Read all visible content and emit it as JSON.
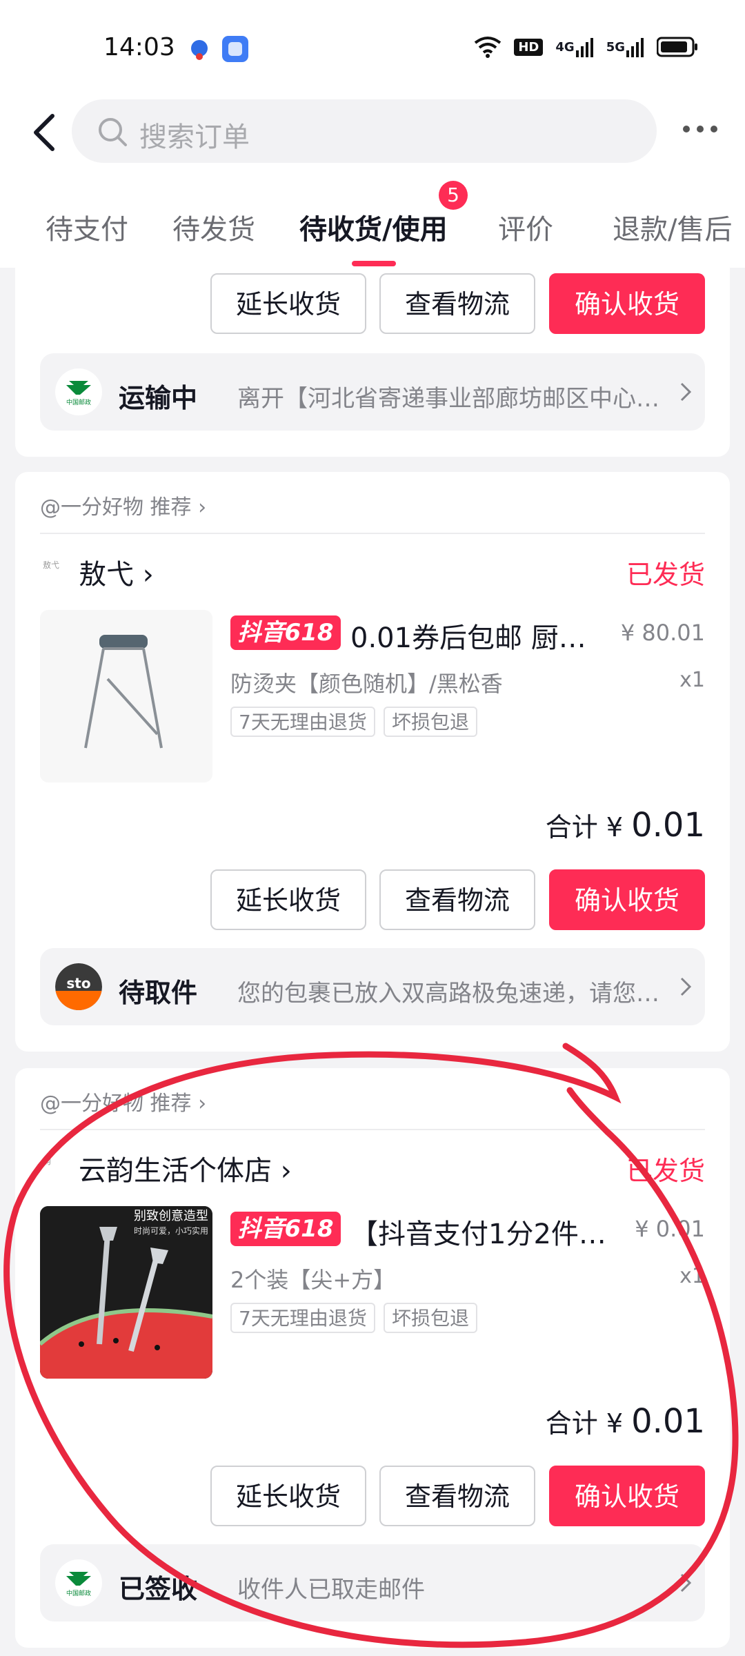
{
  "status_bar": {
    "time": "14:03",
    "network_badges": [
      "HD",
      "4G",
      "5G"
    ]
  },
  "search": {
    "placeholder": "搜索订单"
  },
  "tabs": [
    {
      "label": "待支付"
    },
    {
      "label": "待发货"
    },
    {
      "label": "待收货/使用",
      "badge": "5",
      "active": true
    },
    {
      "label": "评价"
    },
    {
      "label": "退款/售后"
    }
  ],
  "buttons": {
    "extend": "延长收货",
    "logistics": "查看物流",
    "confirm": "确认收货"
  },
  "orders": [
    {
      "logistics": {
        "carrier": "中国邮政 CHINA POST",
        "status": "运输中",
        "desc": "离开【河北省寄递事业部廊坊邮区中心邮…"
      }
    },
    {
      "recommend": "@一分好物 推荐",
      "shop": "敖弋",
      "shop_icon_text": "敖弋",
      "status": "已发货",
      "promo": "抖音618",
      "title": "0.01券后包邮 厨…",
      "price": "¥ 80.01",
      "sku": "防烫夹【颜色随机】/黑松香",
      "qty": "x1",
      "tags": [
        "7天无理由退货",
        "坏损包退"
      ],
      "total_label": "合计 ¥",
      "total_value": "0.01",
      "logistics": {
        "carrier": "sto express",
        "status": "待取件",
        "desc": "您的包裹已放入双高路极兔速递，请您尽…"
      }
    },
    {
      "recommend": "@一分好物 推荐",
      "shop": "云韵生活个体店",
      "shop_icon_text": "韵",
      "status": "已发货",
      "promo": "抖音618",
      "title": "【抖音支付1分2件…",
      "price": "¥ 0.01",
      "sku": "2个装【尖+方】",
      "qty": "x1",
      "thumb_text_1": "别致创意造型",
      "thumb_text_2": "时尚可爱，小巧实用",
      "tags": [
        "7天无理由退货",
        "坏损包退"
      ],
      "total_label": "合计 ¥",
      "total_value": "0.01",
      "logistics": {
        "carrier": "中国邮政 CHINA POST",
        "status": "已签收",
        "desc": "收件人已取走邮件"
      }
    }
  ],
  "colors": {
    "accent": "#fe2c55",
    "annotation": "#e8273f"
  }
}
